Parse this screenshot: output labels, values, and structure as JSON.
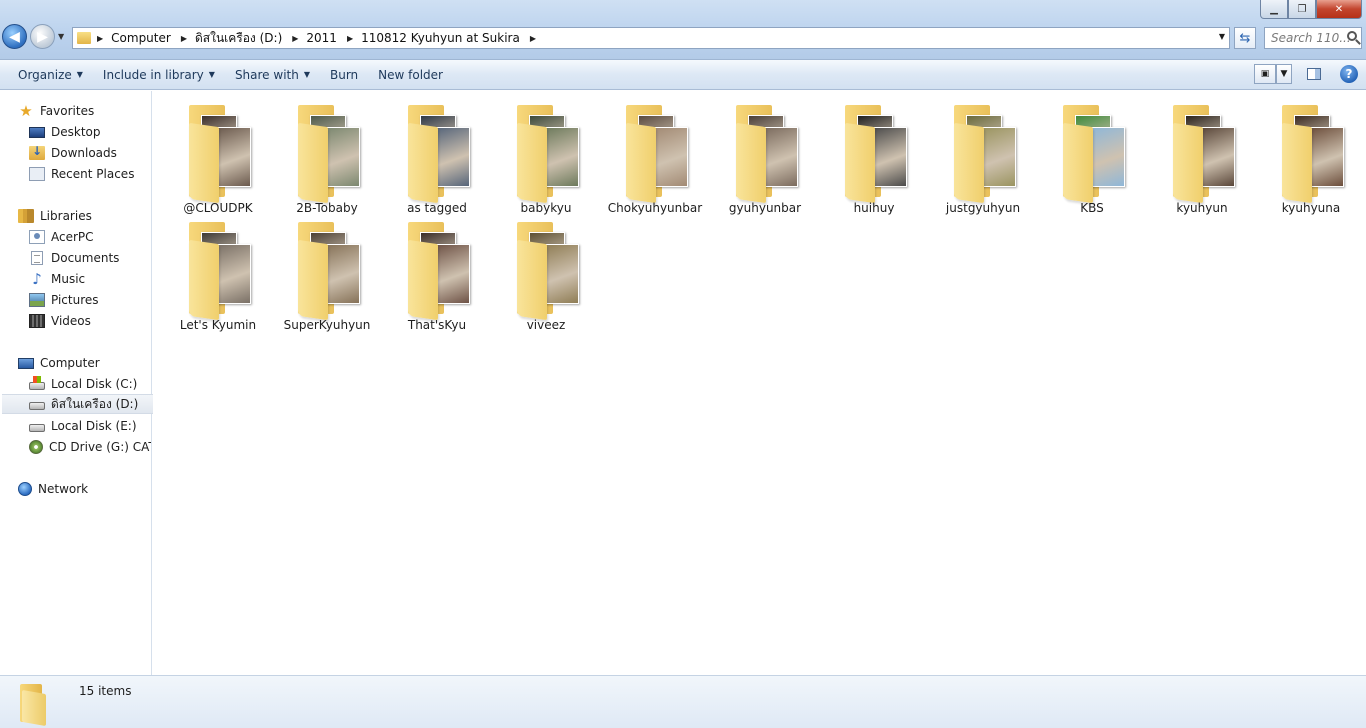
{
  "window": {
    "minimize_label": "▁",
    "maximize_label": "❐",
    "close_label": "✕"
  },
  "address_bar": {
    "crumbs": [
      "Computer",
      "ดิสในเครือง (D:)",
      "2011",
      "110812 Kyuhyun at Sukira"
    ],
    "search_placeholder": "Search 110..."
  },
  "command_bar": {
    "organize": "Organize",
    "include_in_library": "Include in library",
    "share_with": "Share with",
    "burn": "Burn",
    "new_folder": "New folder",
    "help": "?"
  },
  "nav_pane": {
    "favorites": "Favorites",
    "desktop": "Desktop",
    "downloads": "Downloads",
    "recent_places": "Recent Places",
    "libraries": "Libraries",
    "acerpc": "AcerPC",
    "documents": "Documents",
    "music": "Music",
    "pictures": "Pictures",
    "videos": "Videos",
    "computer": "Computer",
    "local_disk_c": "Local Disk (C:)",
    "disk_d": "ดิสในเครือง (D:)",
    "local_disk_e": "Local Disk (E:)",
    "cd_drive": "CD Drive (G:) CAT (",
    "network": "Network"
  },
  "folders": [
    {
      "name": "@CLOUDPK",
      "c1": "#3a2e2a",
      "c2": "#6b5a4e"
    },
    {
      "name": "2B-Tobaby",
      "c1": "#4d5a4a",
      "c2": "#7c8870"
    },
    {
      "name": "as tagged",
      "c1": "#2e3846",
      "c2": "#56657a"
    },
    {
      "name": "babykyu",
      "c1": "#3d4a3a",
      "c2": "#6d7a5c"
    },
    {
      "name": "Chokyuhyunbar",
      "c1": "#5a4b40",
      "c2": "#a28a74"
    },
    {
      "name": "gyuhyunbar",
      "c1": "#4a3f38",
      "c2": "#7b6b5e"
    },
    {
      "name": "huihuy",
      "c1": "#1f1f1f",
      "c2": "#4b4b4b"
    },
    {
      "name": "justgyuhyun",
      "c1": "#6a6a3c",
      "c2": "#9a9460"
    },
    {
      "name": "KBS",
      "c1": "#3f8a3b",
      "c2": "#8fb7d8"
    },
    {
      "name": "kyuhyun",
      "c1": "#2a221c",
      "c2": "#5a473a"
    },
    {
      "name": "kyuhyuna",
      "c1": "#3b2b22",
      "c2": "#6c4e3c"
    },
    {
      "name": "Let's Kyumin",
      "c1": "#3e3a36",
      "c2": "#7a7066"
    },
    {
      "name": "SuperKyuhyun",
      "c1": "#4c4136",
      "c2": "#867258"
    },
    {
      "name": "That'sKyu",
      "c1": "#3a2d28",
      "c2": "#6e5246"
    },
    {
      "name": "viveez",
      "c1": "#5e5134",
      "c2": "#8f7d55"
    }
  ],
  "details": {
    "count": "15 items"
  }
}
